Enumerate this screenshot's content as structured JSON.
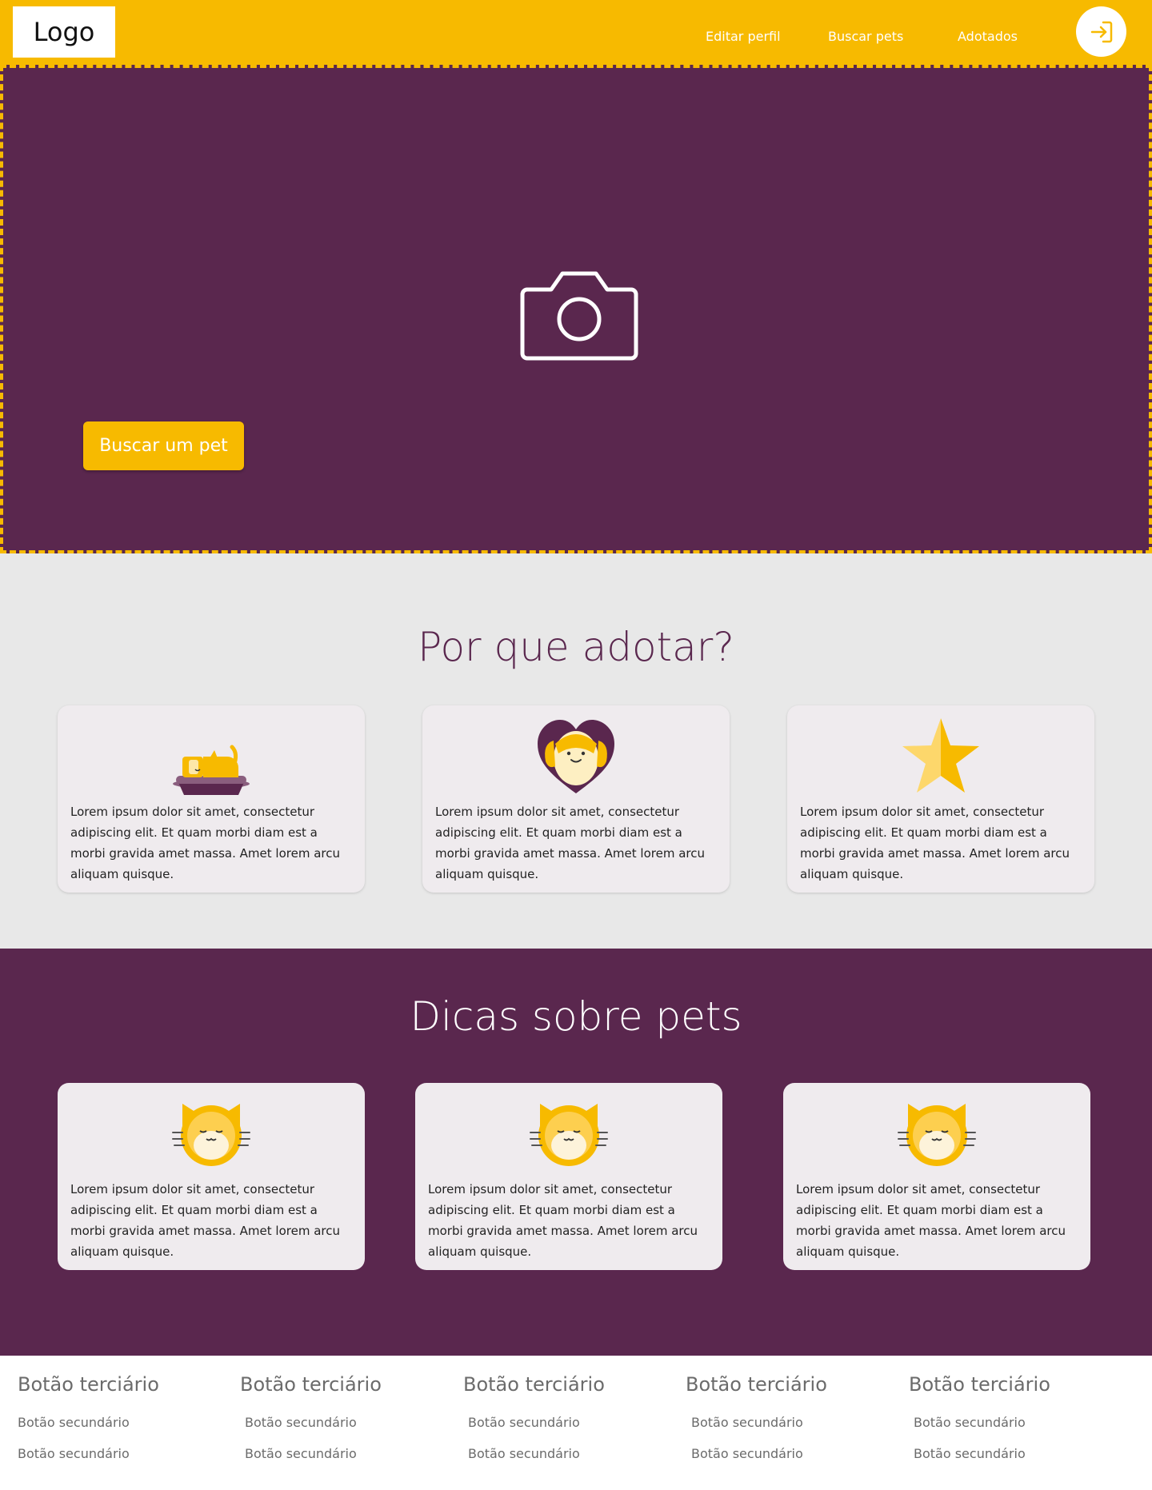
{
  "header": {
    "logo": "Logo",
    "nav": [
      "Editar perfil",
      "Buscar pets",
      "Adotados"
    ],
    "login_icon": "login-arrow-icon"
  },
  "hero": {
    "image_icon": "camera-icon",
    "button_label": "Buscar um pet"
  },
  "why_adopt": {
    "title": "Por que adotar?",
    "cards": [
      {
        "icon": "cat-in-bed-icon",
        "text": "Lorem ipsum dolor sit amet, consectetur adipiscing elit. Et quam morbi diam est a morbi gravida amet massa. Amet lorem arcu aliquam quisque."
      },
      {
        "icon": "dog-heart-icon",
        "text": "Lorem ipsum dolor sit amet, consectetur adipiscing elit. Et quam morbi diam est a morbi gravida amet massa. Amet lorem arcu aliquam quisque."
      },
      {
        "icon": "star-icon",
        "text": "Lorem ipsum dolor sit amet, consectetur adipiscing elit. Et quam morbi diam est a morbi gravida amet massa. Amet lorem arcu aliquam quisque."
      }
    ]
  },
  "tips": {
    "title": "Dicas sobre pets",
    "cards": [
      {
        "icon": "cat-face-icon",
        "text": "Lorem ipsum dolor sit amet, consectetur adipiscing elit. Et quam morbi diam est a morbi gravida amet massa. Amet lorem arcu aliquam quisque."
      },
      {
        "icon": "cat-face-icon",
        "text": "Lorem ipsum dolor sit amet, consectetur adipiscing elit. Et quam morbi diam est a morbi gravida amet massa. Amet lorem arcu aliquam quisque."
      },
      {
        "icon": "cat-face-icon",
        "text": "Lorem ipsum dolor sit amet, consectetur adipiscing elit. Et quam morbi diam est a morbi gravida amet massa. Amet lorem arcu aliquam quisque."
      }
    ]
  },
  "footer": {
    "columns": [
      {
        "title": "Botão terciário",
        "links": [
          "Botão secundário",
          "Botão secundário"
        ]
      },
      {
        "title": "Botão terciário",
        "links": [
          "Botão secundário",
          "Botão secundário"
        ]
      },
      {
        "title": "Botão terciário",
        "links": [
          "Botão secundário",
          "Botão secundário"
        ]
      },
      {
        "title": "Botão terciário",
        "links": [
          "Botão secundário",
          "Botão secundário"
        ]
      },
      {
        "title": "Botão terciário",
        "links": [
          "Botão secundário",
          "Botão secundário"
        ]
      }
    ]
  },
  "colors": {
    "primary_yellow": "#F7BA00",
    "primary_purple": "#5A274E",
    "section_gray": "#E8E8E8",
    "card_bg": "#EFEBEE"
  }
}
